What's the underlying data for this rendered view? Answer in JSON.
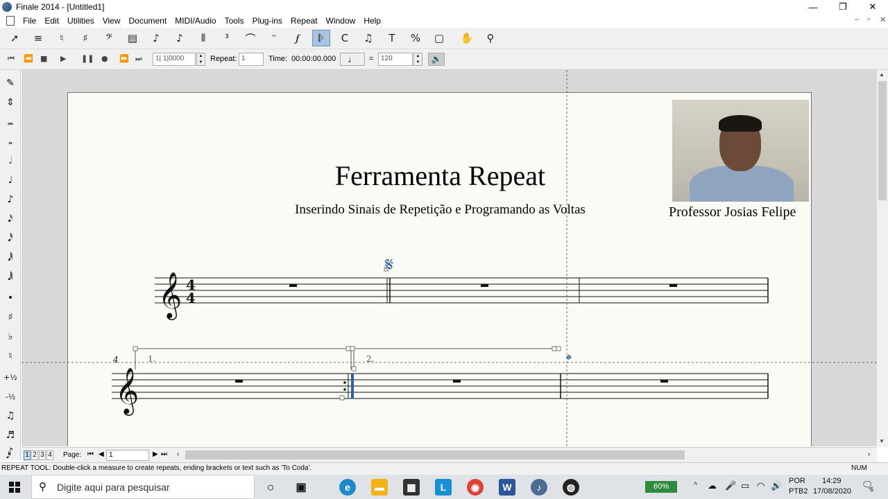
{
  "window": {
    "title": "Finale 2014 - [Untitled1]",
    "minimize": "—",
    "restore": "❐",
    "close": "✕"
  },
  "menu": [
    "File",
    "Edit",
    "Utilities",
    "View",
    "Document",
    "MIDI/Audio",
    "Tools",
    "Plug-ins",
    "Repeat",
    "Window",
    "Help"
  ],
  "mdi": {
    "minimize": "–",
    "restore": "▫",
    "close": "✕"
  },
  "playback": {
    "counter": "1| 1|0000",
    "repeat_label": "Repeat:",
    "repeat_value": "1",
    "time_label": "Time:",
    "time_value": "00:00:00.000",
    "equals": "=",
    "tempo": "120"
  },
  "score": {
    "title": "Ferramenta Repeat",
    "subtitle": "Inserindo Sinais de Repetição e Programando as Voltas",
    "composer": "Professor Josias Felipe",
    "time_signature_top": "4",
    "time_signature_bottom": "4",
    "system2_measure_number": "4",
    "ending1": "1.",
    "ending2": "2.",
    "segno": "𝄋",
    "coda": "𝄌"
  },
  "pages": {
    "label": "Page:",
    "tabs": [
      "1",
      "2",
      "3",
      "4"
    ],
    "current": "1"
  },
  "status": {
    "message": "REPEAT TOOL: Double-click a measure to create repeats, ending brackets or text such as 'To Coda'.",
    "num": "NUM"
  },
  "taskbar": {
    "search_placeholder": "Digite aqui para pesquisar",
    "battery": "60%",
    "lang1": "POR",
    "lang2": "PTB2",
    "time": "14:29",
    "date": "17/08/2020",
    "notifications": "6"
  },
  "colors": {
    "accent": "#2f5f9f",
    "toolbar": "#f0f0f0",
    "page": "#fbfbf6"
  }
}
